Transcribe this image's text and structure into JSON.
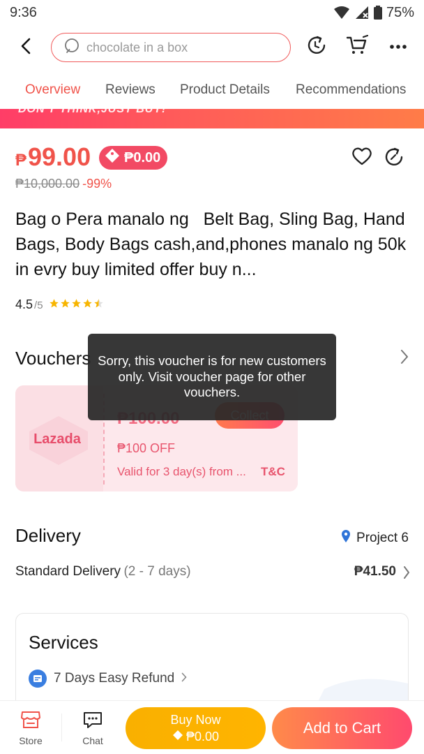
{
  "status_bar": {
    "time": "9:36",
    "battery": "75%"
  },
  "search": {
    "placeholder": "chocolate in a box"
  },
  "tabs": [
    {
      "label": "Overview",
      "active": true
    },
    {
      "label": "Reviews",
      "active": false
    },
    {
      "label": "Product Details",
      "active": false
    },
    {
      "label": "Recommendations",
      "active": false
    }
  ],
  "promo_banner": {
    "text": "DON'T THINK,JUST BUY!"
  },
  "product": {
    "currency": "₱",
    "price": "99.00",
    "badge_price": "₱0.00",
    "original_price": "₱10,000.00",
    "discount": "-99%",
    "title": "Bag o Pera manalo ng   Belt Bag, Sling Bag, Hand Bags, Body Bags cash,and,phones manalo ng 50k in evry buy limited offer buy n...",
    "rating": "4.5",
    "rating_out_of": "/5",
    "rating_value": 4.5
  },
  "vouchers": {
    "title": "Vouchers",
    "item": {
      "logo_text": "Lazada",
      "amount": "₱100.00",
      "collect_label": "Collect",
      "off_text": "₱100 OFF",
      "valid_text": "Valid for 3 day(s) from ...",
      "tc_label": "T&C"
    }
  },
  "toast": {
    "message": "Sorry, this voucher is for new customers only. Visit voucher page for other vouchers."
  },
  "delivery": {
    "title": "Delivery",
    "location": "Project 6",
    "option_label": "Standard Delivery",
    "option_days": "(2 - 7 days)",
    "fee": "₱41.50"
  },
  "services": {
    "title": "Services",
    "items": [
      {
        "label": "7 Days Easy Refund"
      }
    ]
  },
  "bottom_bar": {
    "store_label": "Store",
    "chat_label": "Chat",
    "buy_now_label": "Buy Now",
    "buy_now_price": "₱0.00",
    "add_to_cart_label": "Add to Cart"
  },
  "colors": {
    "accent": "#f0534a",
    "buy_now": "#ffb400",
    "add_to_cart": "#ff4a6e",
    "badge": "#f24a64"
  }
}
